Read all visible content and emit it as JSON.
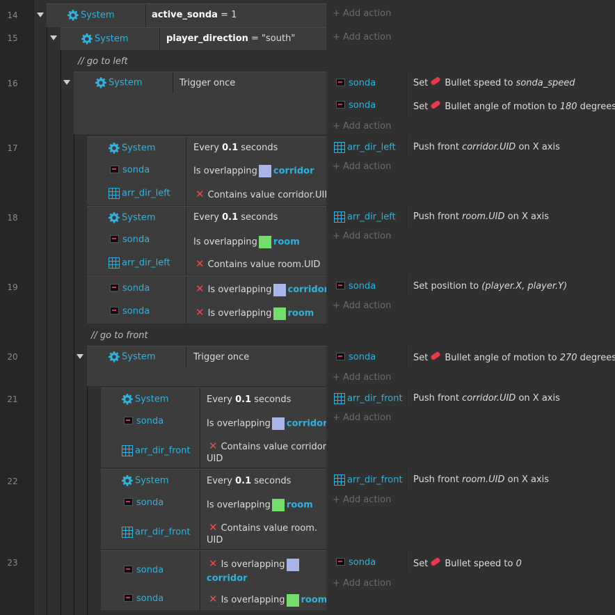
{
  "gutter": {
    "line_numbers": [
      "14",
      "15",
      "16",
      "17",
      "18",
      "19",
      "20",
      "21",
      "22",
      "23"
    ]
  },
  "ui": {
    "add_action": "+ Add action"
  },
  "icons": {
    "system": "gear-icon",
    "sprite": "sprite-icon",
    "array": "array-grid-icon",
    "invert": "cross-icon",
    "bullet": "bullet-behavior-icon"
  },
  "colors": {
    "accent": "#2fb2dd",
    "invert": "#f04a4a",
    "corridor": "#a9b4e8",
    "room": "#74dc6a",
    "bullet": "#e8394a"
  },
  "ev14": {
    "obj": "System",
    "var": "active_sonda",
    "rest": "= 1"
  },
  "ev15": {
    "obj": "System",
    "var": "player_direction",
    "rest": "= \"south\""
  },
  "comment1": "// go to left",
  "ev16": {
    "obj": "System",
    "cond": "Trigger once",
    "a1_obj": "sonda",
    "a1_set": "Set",
    "a1_text": "Bullet speed to",
    "a1_val": "sonda_speed",
    "a2_obj": "sonda",
    "a2_set": "Set",
    "a2_text": "Bullet angle of motion to",
    "a2_val": "180",
    "a2_suffix": "degrees"
  },
  "ev17": {
    "c1_obj": "System",
    "c1_pre": "Every",
    "c1_num": "0.1",
    "c1_post": "seconds",
    "c2_obj": "sonda",
    "c2_text": "Is overlapping",
    "c2_target": "corridor",
    "c3_obj": "arr_dir_left",
    "c3_text": "Contains value corridor.UID",
    "a1_obj": "arr_dir_left",
    "a1_pre": "Push front",
    "a1_val": "corridor.UID",
    "a1_post": "on X axis"
  },
  "ev18": {
    "c1_obj": "System",
    "c1_pre": "Every",
    "c1_num": "0.1",
    "c1_post": "seconds",
    "c2_obj": "sonda",
    "c2_text": "Is overlapping",
    "c2_target": "room",
    "c3_obj": "arr_dir_left",
    "c3_text": "Contains value room.UID",
    "a1_obj": "arr_dir_left",
    "a1_pre": "Push front",
    "a1_val": "room.UID",
    "a1_post": "on X axis"
  },
  "ev19": {
    "c1_obj": "sonda",
    "c1_text": "Is overlapping",
    "c1_target": "corridor",
    "c2_obj": "sonda",
    "c2_text": "Is overlapping",
    "c2_target": "room",
    "a1_obj": "sonda",
    "a1_pre": "Set position to",
    "a1_val": "(player.X, player.Y)"
  },
  "comment2": "// go to front",
  "ev20": {
    "obj": "System",
    "cond": "Trigger once",
    "a1_obj": "sonda",
    "a1_set": "Set",
    "a1_text": "Bullet angle of motion to",
    "a1_val": "270",
    "a1_suffix": "degrees"
  },
  "ev21": {
    "c1_obj": "System",
    "c1_pre": "Every",
    "c1_num": "0.1",
    "c1_post": "seconds",
    "c2_obj": "sonda",
    "c2_text": "Is overlapping",
    "c2_target": "corridor",
    "c3_obj": "arr_dir_front",
    "c3_line1": "Contains value corridor.",
    "c3_line2": "UID",
    "a1_obj": "arr_dir_front",
    "a1_pre": "Push front",
    "a1_val": "corridor.UID",
    "a1_post": "on X axis"
  },
  "ev22": {
    "c1_obj": "System",
    "c1_pre": "Every",
    "c1_num": "0.1",
    "c1_post": "seconds",
    "c2_obj": "sonda",
    "c2_text": "Is overlapping",
    "c2_target": "room",
    "c3_obj": "arr_dir_front",
    "c3_line1": "Contains value room.",
    "c3_line2": "UID",
    "a1_obj": "arr_dir_front",
    "a1_pre": "Push front",
    "a1_val": "room.UID",
    "a1_post": "on X axis"
  },
  "ev23": {
    "c1_obj": "sonda",
    "c1_text": "Is overlapping",
    "c1_target": "corridor",
    "c2_obj": "sonda",
    "c2_text": "Is overlapping",
    "c2_target": "room",
    "a1_obj": "sonda",
    "a1_set": "Set",
    "a1_text": "Bullet speed to",
    "a1_val": "0"
  }
}
